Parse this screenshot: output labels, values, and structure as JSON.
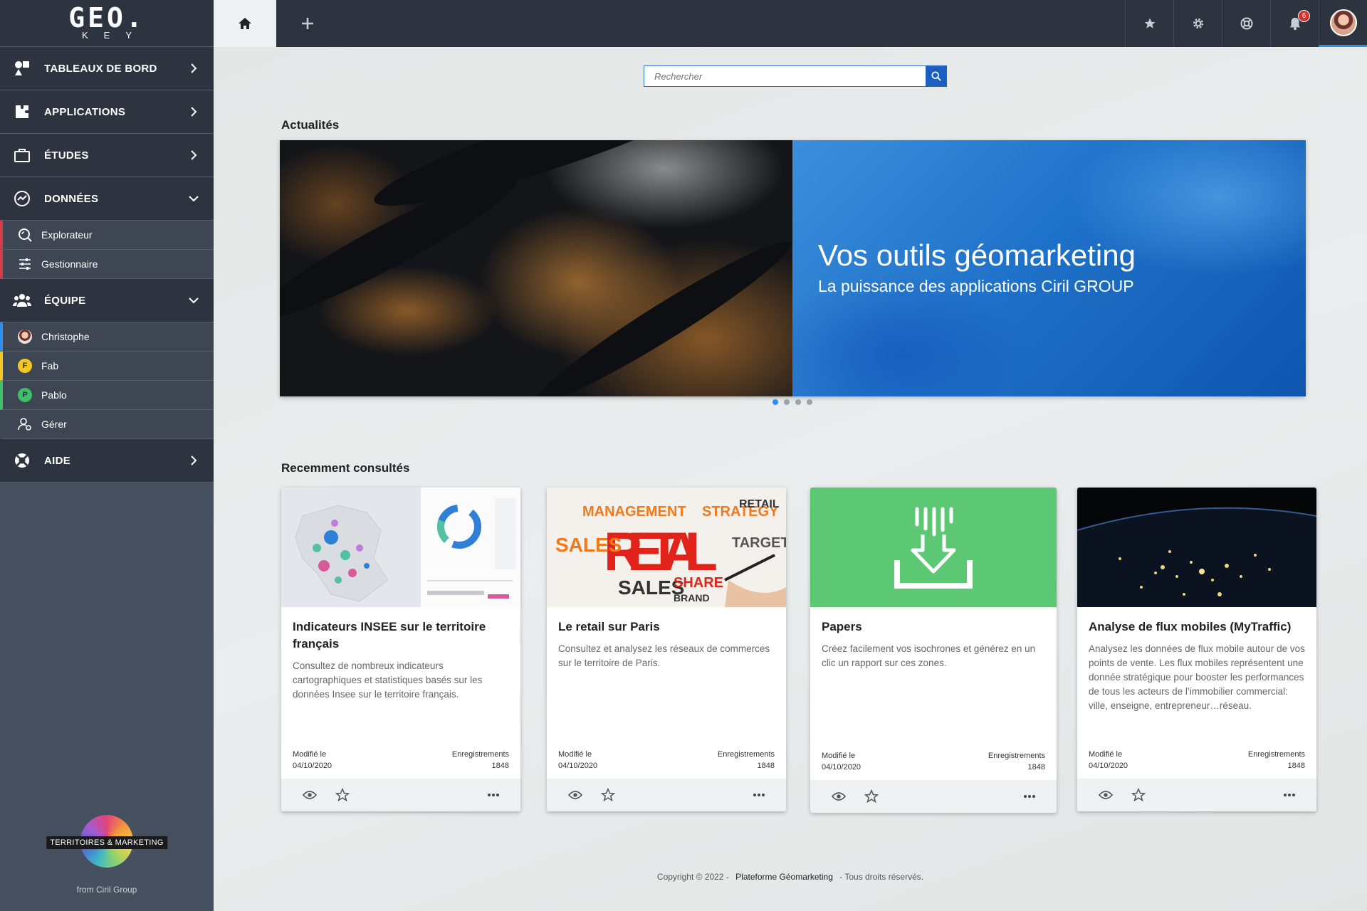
{
  "logo": {
    "main": "GEO.",
    "sub": "KEY"
  },
  "sidebar": {
    "items": [
      {
        "label": "TABLEAUX DE BORD",
        "icon": "shapes-icon"
      },
      {
        "label": "APPLICATIONS",
        "icon": "puzzle-icon"
      },
      {
        "label": "ÉTUDES",
        "icon": "briefcase-icon"
      },
      {
        "label": "DONNÉES",
        "icon": "data-chart-icon"
      },
      {
        "label": "ÉQUIPE",
        "icon": "team-icon"
      },
      {
        "label": "AIDE",
        "icon": "lifebuoy-icon"
      }
    ],
    "donnees_sub": [
      {
        "label": "Explorateur",
        "icon": "explore-icon"
      },
      {
        "label": "Gestionnaire",
        "icon": "sliders-icon"
      }
    ],
    "equipe_sub": [
      {
        "label": "Christophe",
        "avatar": "photo"
      },
      {
        "label": "Fab",
        "initial": "F",
        "color": "#f3c623"
      },
      {
        "label": "Pablo",
        "initial": "P",
        "color": "#3fbf6a"
      },
      {
        "label": "Gérer",
        "icon": "user-settings-icon"
      }
    ],
    "sub_accents": {
      "donnees": "#d93a4a",
      "christophe": "#2c8ff2",
      "fab": "#f3c623",
      "pablo": "#3fbf6a"
    },
    "brand_label": "TERRITOIRES & MARKETING",
    "brand_from": "from Ciril Group"
  },
  "topbar": {
    "notifications": "6"
  },
  "search": {
    "placeholder": "Rechercher"
  },
  "news": {
    "title": "Actualités",
    "headline": "Vos outils géomarketing",
    "subheadline": "La puissance des applications Ciril GROUP",
    "slide_count": 4,
    "active_slide": 0
  },
  "recent": {
    "title": "Recemment consultés",
    "cards": [
      {
        "title": "Indicateurs INSEE sur le territoire français",
        "description": "Consultez de nombreux indicateurs cartographiques et statistiques basés sur les données Insee sur le territoire français.",
        "modified_label": "Modifié le",
        "modified_date": "04/10/2020",
        "records_label": "Enregistrements",
        "records": "1848"
      },
      {
        "title": "Le retail sur Paris",
        "description": "Consultez et analysez les réseaux de commerces sur le territoire de Paris.",
        "modified_label": "Modifié le",
        "modified_date": "04/10/2020",
        "records_label": "Enregistrements",
        "records": "1848"
      },
      {
        "title": "Papers",
        "description": "Créez facilement vos isochrones et générez en un clic un rapport sur ces zones.",
        "modified_label": "Modifié le",
        "modified_date": "04/10/2020",
        "records_label": "Enregistrements",
        "records": "1848"
      },
      {
        "title": "Analyse de flux mobiles (MyTraffic)",
        "description": "Analysez les données de flux mobile autour de vos points de vente. Les flux mobiles représentent une donnée stratégique pour booster les performances de tous les acteurs de l’immobilier commercial: ville, enseigne, entrepreneur…réseau.",
        "modified_label": "Modifié le",
        "modified_date": "04/10/2020",
        "records_label": "Enregistrements",
        "records": "1848"
      }
    ]
  },
  "retail_words": {
    "big": "RETAIL",
    "sales": "SALES",
    "management": "MANAGEMENT",
    "strategy": "STRATEGY",
    "target": "TARGET",
    "share": "SHARE",
    "brand": "BRAND",
    "retail_small": "RETAIL"
  },
  "footer": {
    "copyright": "Copyright © 2022 -",
    "link": "Plateforme Géomarketing",
    "rights": "- Tous droits réservés."
  },
  "colors": {
    "accent": "#2c8ff2",
    "dark": "#2d3440",
    "sidebar": "#47505f",
    "search_button": "#1c5fc0",
    "papers_green": "#5cc873"
  }
}
